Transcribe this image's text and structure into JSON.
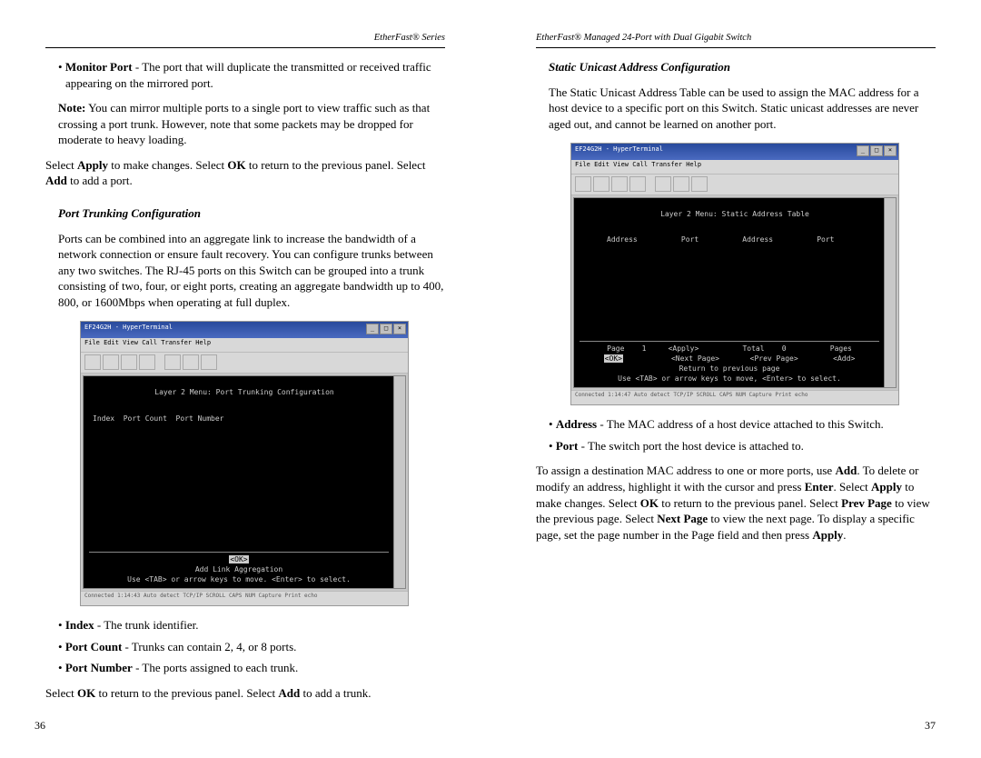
{
  "left": {
    "header": "EtherFast® Series",
    "bullet1_label": "Monitor Port",
    "bullet1_text": " - The port that will duplicate the transmitted or received traffic appearing on the mirrored port.",
    "note_label": "Note:",
    "note_text": " You can mirror multiple ports to a single port to view traffic such as that crossing a port trunk. However, note that some packets may be dropped for moderate to heavy loading.",
    "select_text_1a": "Select ",
    "select_text_1b": " to make changes. Select ",
    "select_text_1c": " to return to the previous panel. Select ",
    "select_text_1d": " to add a port.",
    "apply": "Apply",
    "ok": "OK",
    "add": "Add",
    "section_title": "Port Trunking Configuration",
    "section_para": "Ports can be combined into an aggregate link to increase the bandwidth of a network connection or ensure fault recovery. You can configure trunks between any two switches. The RJ-45 ports on this Switch can be grouped into a trunk consisting of two, four, or eight ports, creating an aggregate bandwidth up to 400, 800, or 1600Mbps when operating at full duplex.",
    "screenshot": {
      "title": "EF24G2H - HyperTerminal",
      "menu": "File  Edit  View  Call  Transfer  Help",
      "term_header": "Layer 2 Menu: Port Trunking Configuration",
      "term_cols": "Index  Port Count  Port Number",
      "term_add": "Add Link Aggregation",
      "term_ok": "<OK>",
      "term_hint": "Use <TAB> or arrow keys to move. <Enter> to select.",
      "status": "Connected 1:14:43      Auto detect      TCP/IP      SCROLL   CAPS   NUM   Capture   Print echo"
    },
    "bullet_index_label": "Index",
    "bullet_index_text": " - The trunk identifier.",
    "bullet_pc_label": "Port Count",
    "bullet_pc_text": " - Trunks can contain 2, 4, or 8 ports.",
    "bullet_pn_label": "Port Number",
    "bullet_pn_text": " - The ports assigned to each trunk.",
    "final_1": "Select ",
    "final_2": " to return to the previous panel. Select ",
    "final_3": " to add a trunk.",
    "pageno": "36"
  },
  "right": {
    "header": "EtherFast® Managed 24-Port with Dual Gigabit Switch",
    "section_title": "Static Unicast Address Configuration",
    "section_para": "The Static Unicast Address Table can be used to assign the MAC address for a host device to a specific port on this Switch. Static unicast addresses are never aged out, and cannot be learned on another port.",
    "screenshot": {
      "title": "EF24G2H - HyperTerminal",
      "menu": "File  Edit  View  Call  Transfer  Help",
      "term_header": "Layer 2 Menu: Static Address Table",
      "term_cols": "Address          Port          Address          Port",
      "term_page_line": "Page    1     <Apply>          Total    0          Pages",
      "term_nav_line": "<OK>           <Next Page>       <Prev Page>        <Add>",
      "term_return": "Return to previous page",
      "term_hint": "Use <TAB> or arrow keys to move, <Enter> to select.",
      "status": "Connected 1:14:47      Auto detect      TCP/IP      SCROLL   CAPS   NUM   Capture   Print echo"
    },
    "bullet_addr_label": "Address",
    "bullet_addr_text": " - The MAC address of a host device attached to this Switch.",
    "bullet_port_label": "Port",
    "bullet_port_text": " - The switch port the host device is attached to.",
    "final_para_1": "To assign a destination MAC address to one or more ports, use ",
    "final_para_2": ". To delete or modify an address, highlight it with the cursor and press ",
    "final_para_3": ". Select ",
    "final_para_4": " to make changes. Select ",
    "final_para_5": " to return to the previous panel. Select ",
    "final_para_6": " to view the previous page. Select ",
    "final_para_7": " to view the next page. To display a specific page, set the page number in the Page field and then press ",
    "final_para_8": ".",
    "add": "Add",
    "enter": "Enter",
    "apply": "Apply",
    "ok": "OK",
    "prevpage": "Prev Page",
    "nextpage": "Next Page",
    "pageno": "37"
  }
}
